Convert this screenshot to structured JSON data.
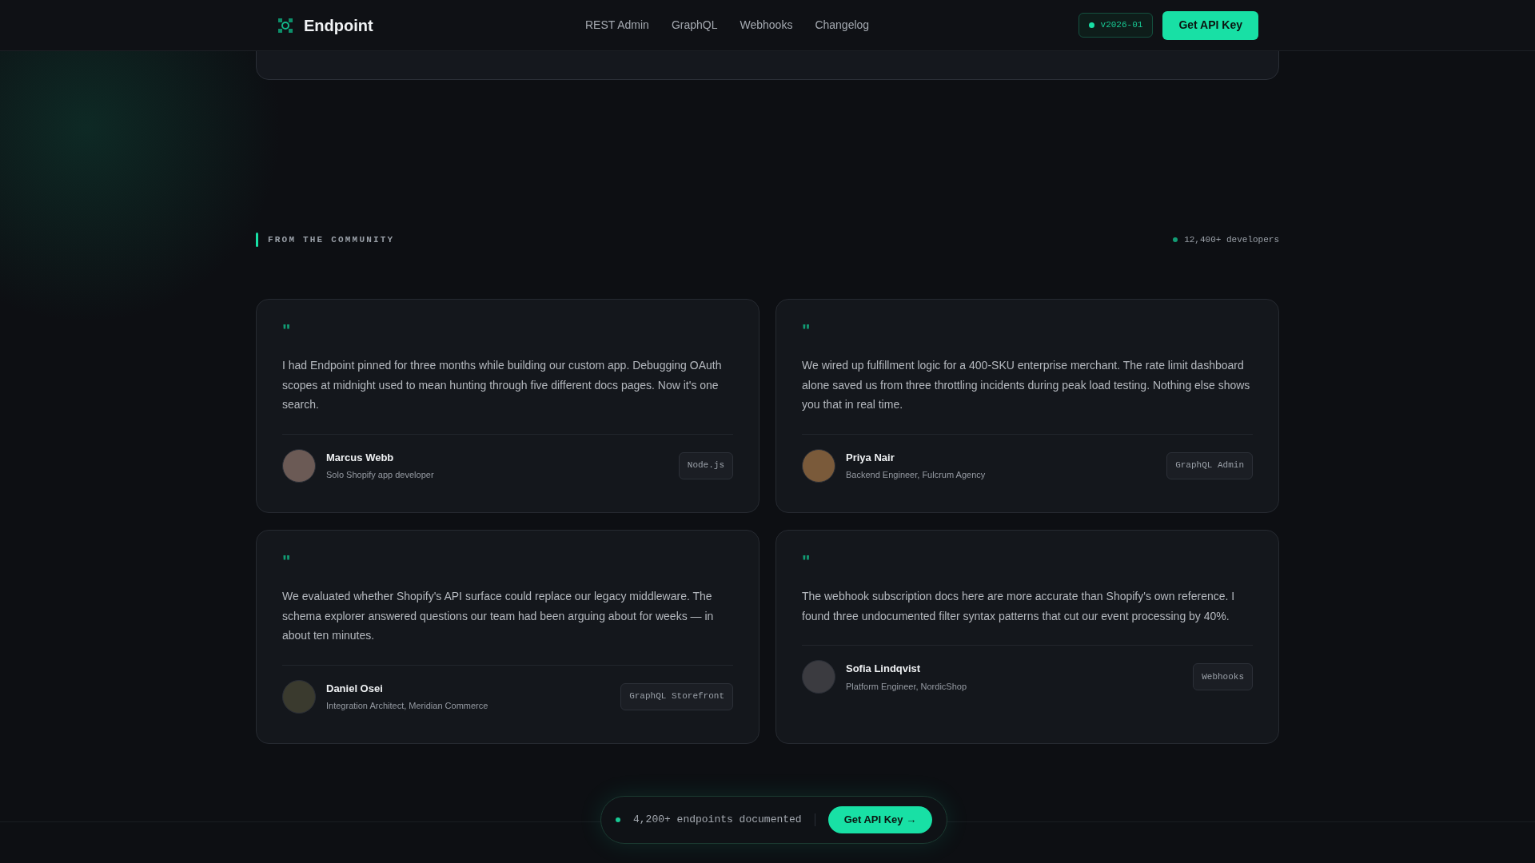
{
  "header": {
    "brand": "Endpoint",
    "nav": [
      {
        "label": "REST Admin"
      },
      {
        "label": "GraphQL"
      },
      {
        "label": "Webhooks"
      },
      {
        "label": "Changelog"
      }
    ],
    "version": "v2026-01",
    "cta": "Get API Key"
  },
  "section": {
    "eyebrow": "FROM THE COMMUNITY",
    "stat": "12,400+ developers"
  },
  "testimonials": [
    {
      "quote_mark": "\"",
      "text": "I had Endpoint pinned for three months while building our custom app. Debugging OAuth scopes at midnight used to mean hunting through five different docs pages. Now it's one search.",
      "name": "Marcus Webb",
      "role": "Solo Shopify app developer",
      "tag": "Node.js"
    },
    {
      "quote_mark": "\"",
      "text": "We wired up fulfillment logic for a 400-SKU enterprise merchant. The rate limit dashboard alone saved us from three throttling incidents during peak load testing. Nothing else shows you that in real time.",
      "name": "Priya Nair",
      "role": "Backend Engineer, Fulcrum Agency",
      "tag": "GraphQL Admin"
    },
    {
      "quote_mark": "\"",
      "text": "We evaluated whether Shopify's API surface could replace our legacy middleware. The schema explorer answered questions our team had been arguing about for weeks — in about ten minutes.",
      "name": "Daniel Osei",
      "role": "Integration Architect, Meridian Commerce",
      "tag": "GraphQL Storefront"
    },
    {
      "quote_mark": "\"",
      "text": "The webhook subscription docs here are more accurate than Shopify's own reference. I found three undocumented filter syntax patterns that cut our event processing by 40%.",
      "name": "Sofia Lindqvist",
      "role": "Platform Engineer, NordicShop",
      "tag": "Webhooks"
    }
  ],
  "floating_bar": {
    "text": "4,200+ endpoints documented",
    "cta": "Get API Key →"
  }
}
